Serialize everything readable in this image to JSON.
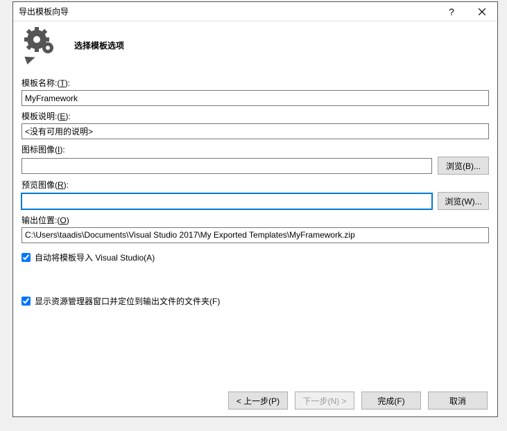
{
  "titlebar": {
    "title": "导出模板向导"
  },
  "header": {
    "subtitle": "选择模板选项"
  },
  "labels": {
    "templateName_pre": "模板名称:(",
    "templateName_u": "T",
    "templateName_post": "):",
    "templateDesc_pre": "模板说明:(",
    "templateDesc_u": "E",
    "templateDesc_post": "):",
    "iconImage_pre": "图标图像(",
    "iconImage_u": "I",
    "iconImage_post": "):",
    "previewImage_pre": "预览图像(",
    "previewImage_u": "R",
    "previewImage_post": "):",
    "outputLoc_pre": "输出位置:(",
    "outputLoc_u": "O",
    "outputLoc_post": ")",
    "browse_b_pre": "浏览(",
    "browse_b_u": "B",
    "browse_b_post": ")...",
    "browse_w_pre": "浏览(",
    "browse_w_u": "W",
    "browse_w_post": ")...",
    "chk_autoimport_pre": "自动将模板导入 Visual Studio(",
    "chk_autoimport_u": "A",
    "chk_autoimport_post": ")",
    "chk_explorer_pre": "显示资源管理器窗口并定位到输出文件的文件夹(",
    "chk_explorer_u": "F",
    "chk_explorer_post": ")",
    "btn_prev_pre": "< 上一步(",
    "btn_prev_u": "P",
    "btn_prev_post": ")",
    "btn_next_pre": "下一步(",
    "btn_next_u": "N",
    "btn_next_post": ") >",
    "btn_finish_pre": "完成(",
    "btn_finish_u": "F",
    "btn_finish_post": ")",
    "btn_cancel": "取消"
  },
  "fields": {
    "templateName": "MyFramework",
    "templateDesc": "<没有可用的说明>",
    "iconImage": "",
    "previewImage": "",
    "outputLocation": "C:\\Users\\taadis\\Documents\\Visual Studio 2017\\My Exported Templates\\MyFramework.zip"
  },
  "checkboxes": {
    "autoImport": true,
    "showExplorer": true
  }
}
